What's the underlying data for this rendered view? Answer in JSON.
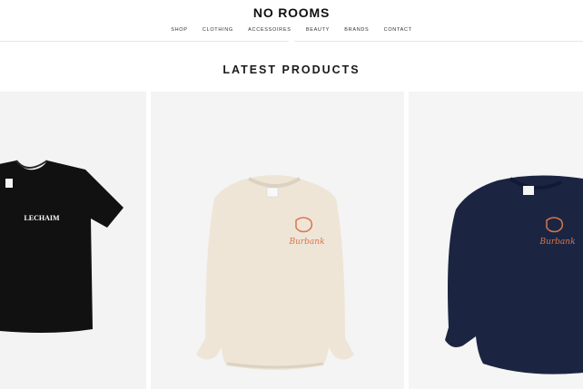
{
  "header": {
    "logo": "NO ROOMS",
    "nav": [
      "SHOP",
      "CLOTHING",
      "ACCESSOIRES",
      "BEAUTY",
      "BRANDS",
      "CONTACT"
    ]
  },
  "main": {
    "section_title": "LATEST PRODUCTS",
    "products": [
      {
        "image_alt": "black t-shirt",
        "print_text": "LECHAIM",
        "color": "#111111"
      },
      {
        "image_alt": "cream sweatshirt",
        "print_text": "Burbank",
        "color": "#eee5d7"
      },
      {
        "image_alt": "navy sweatshirt",
        "print_text": "Burbank",
        "color": "#1b2542"
      }
    ]
  },
  "colors": {
    "accent_print": "#d9764c"
  }
}
